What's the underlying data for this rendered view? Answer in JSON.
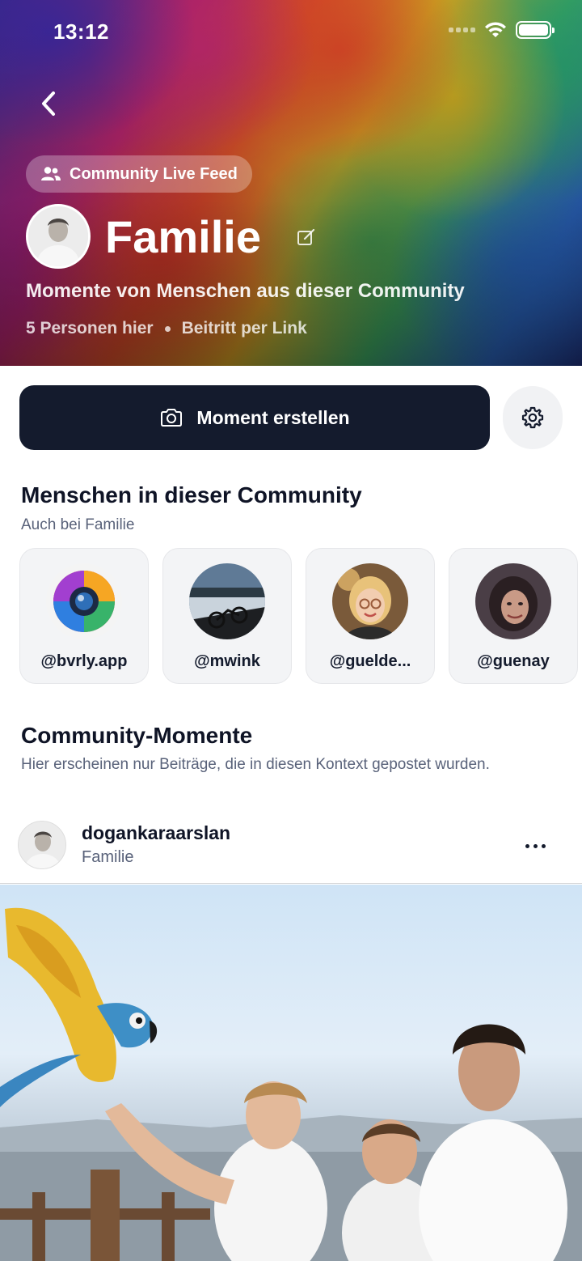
{
  "status_bar": {
    "time": "13:12"
  },
  "hero": {
    "badge_label": "Community Live Feed",
    "title": "Familie",
    "subtitle": "Momente von Menschen aus dieser Community",
    "member_count": "5 Personen hier",
    "join_method": "Beitritt per Link"
  },
  "actions": {
    "create_label": "Moment erstellen"
  },
  "people_section": {
    "title": "Menschen in dieser Community",
    "subtitle": "Auch bei Familie",
    "people": [
      {
        "handle": "@bvrly.app"
      },
      {
        "handle": "@mwink"
      },
      {
        "handle": "@guelde..."
      },
      {
        "handle": "@guenay"
      }
    ]
  },
  "moments_section": {
    "title": "Community-Momente",
    "subtitle": "Hier erscheinen nur Beiträge, die in diesen Kontext gepostet wurden."
  },
  "post": {
    "username": "dogankaraarslan",
    "context": "Familie"
  },
  "colors": {
    "primary_button": "#141b2d",
    "muted_text": "#59627a",
    "card_bg": "#f3f4f6"
  }
}
